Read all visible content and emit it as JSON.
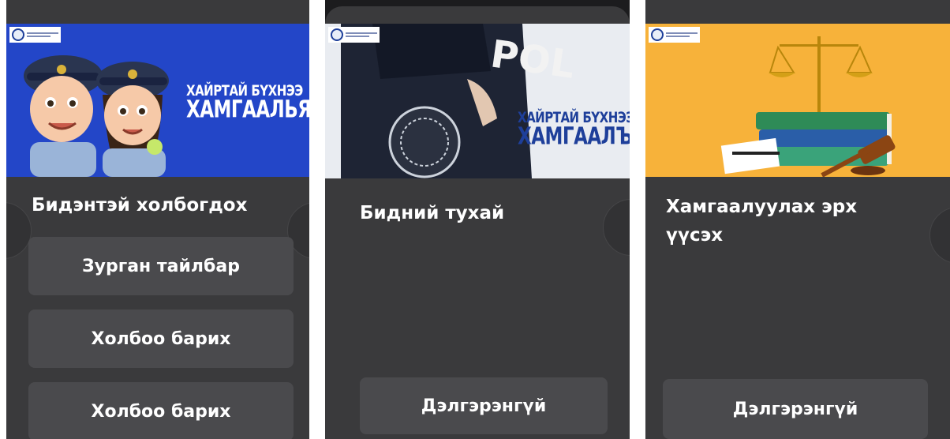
{
  "cards": [
    {
      "banner_line1": "ХАЙРТАЙ БҮХНЭЭ",
      "banner_line2": "ХАМГААЛЬЯ",
      "title": "Бидэнтэй холбогдох",
      "buttons": [
        "Зурган тайлбар",
        "Холбоо барих",
        "Холбоо барих"
      ]
    },
    {
      "banner_text": "POL",
      "banner_line1": "ХАЙРТАЙ БҮХНЭЭ",
      "banner_line2": "ХАМГААЛЪЯ",
      "title": "Бидний тухай",
      "button": "Дэлгэрэнгүй"
    },
    {
      "title": "Хамгаалуулах эрх үүсэх",
      "button": "Дэлгэрэнгүй"
    }
  ],
  "colors": {
    "banner1_bg": "#2346c8",
    "banner3_bg": "#f7b23a",
    "card_bg": "#3a3a3c",
    "button_bg": "#4a4a4d"
  }
}
